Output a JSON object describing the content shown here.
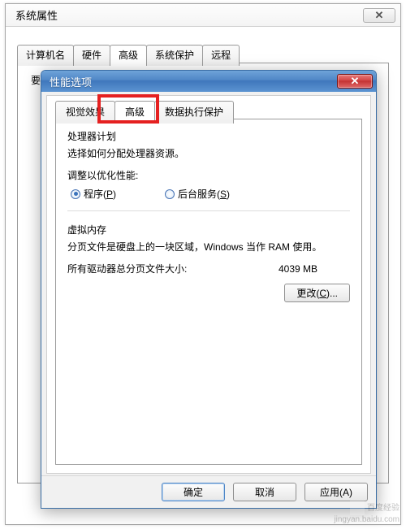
{
  "outer": {
    "title": "系统属性",
    "close_glyph": "✕",
    "tabs": [
      "计算机名",
      "硬件",
      "高级",
      "系统保护",
      "远程"
    ],
    "selected_index": 2,
    "panel_hint": "要进行大多数更改，您必须作为管理员登录。"
  },
  "inner": {
    "title": "性能选项",
    "close_glyph": "✕",
    "tabs": [
      "视觉效果",
      "高级",
      "数据执行保护"
    ],
    "selected_index": 1,
    "processor": {
      "title": "处理器计划",
      "desc": "选择如何分配处理器资源。",
      "adjust_label": "调整以优化性能:",
      "opt_programs_prefix": "程序(",
      "opt_programs_hotkey": "P",
      "opt_programs_suffix": ")",
      "opt_services_prefix": "后台服务(",
      "opt_services_hotkey": "S",
      "opt_services_suffix": ")",
      "selected": "programs"
    },
    "vm": {
      "title": "虚拟内存",
      "desc": "分页文件是硬盘上的一块区域，Windows 当作 RAM 使用。",
      "total_label": "所有驱动器总分页文件大小:",
      "total_value": "4039 MB",
      "change_prefix": "更改(",
      "change_hotkey": "C",
      "change_suffix": ")..."
    },
    "buttons": {
      "ok": "确定",
      "cancel": "取消",
      "apply": "应用(A)"
    }
  },
  "watermark": {
    "line1": "百度经验",
    "line2": "jingyan.baidu.com"
  }
}
